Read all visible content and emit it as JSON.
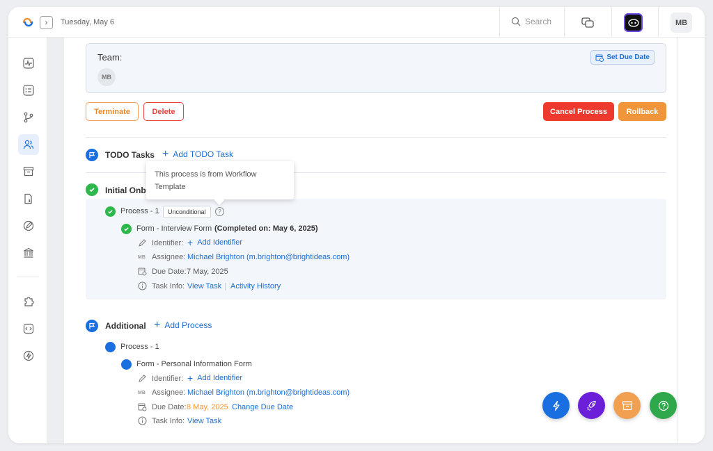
{
  "topbar": {
    "date": "Tuesday, May 6",
    "search_placeholder": "Search",
    "user_initials": "MB"
  },
  "team": {
    "label": "Team:",
    "member_initials": "MB",
    "set_due_date": "Set Due Date"
  },
  "actions": {
    "terminate": "Terminate",
    "delete": "Delete",
    "cancel_process": "Cancel Process",
    "rollback": "Rollback"
  },
  "todo": {
    "title": "TODO Tasks",
    "add_label": "Add TODO Task"
  },
  "tooltip": {
    "text": "This process is from Workflow Template"
  },
  "initial_stage": {
    "title": "Initial Onb",
    "process": {
      "label": "Process - 1",
      "badge": "Unconditional",
      "form": {
        "label": "Form - Interview Form",
        "completed": "(Completed on: May 6, 2025)",
        "identifier_label": "Identifier:",
        "add_identifier": "Add Identifier",
        "assignee_initials": "MB",
        "assignee_label": "Assignee:",
        "assignee_value": "Michael Brighton (m.brighton@brightideas.com)",
        "due_label": "Due Date:",
        "due_value": "7 May, 2025",
        "task_info_label": "Task Info:",
        "view_task": "View Task",
        "sep": "|",
        "activity_history": "Activity History"
      }
    }
  },
  "additional_stage": {
    "title": "Additional",
    "add_process": "Add Process",
    "process": {
      "label": "Process - 1",
      "form": {
        "label": "Form - Personal Information Form",
        "identifier_label": "Identifier:",
        "add_identifier": "Add Identifier",
        "assignee_initials": "MB",
        "assignee_label": "Assignee:",
        "assignee_value": "Michael Brighton (m.brighton@brightideas.com)",
        "due_label": "Due Date:",
        "due_value": "8 May, 2025",
        "change_due": "Change Due Date",
        "task_info_label": "Task Info:",
        "view_task": "View Task"
      }
    }
  },
  "colors": {
    "primary": "#1a6fe0",
    "success": "#2db84c",
    "danger": "#ee3a2e",
    "warning": "#f0953a",
    "purple": "#6b1fd8"
  },
  "sidebar_icons": [
    "activity-icon",
    "checklist-icon",
    "branch-icon",
    "users-icon",
    "archive-icon",
    "document-chart-icon",
    "edit-icon",
    "bank-icon",
    "puzzle-icon",
    "code-icon",
    "bolt-icon"
  ],
  "fab_icons": [
    "bolt-icon",
    "rocket-icon",
    "archive-icon",
    "help-icon"
  ]
}
